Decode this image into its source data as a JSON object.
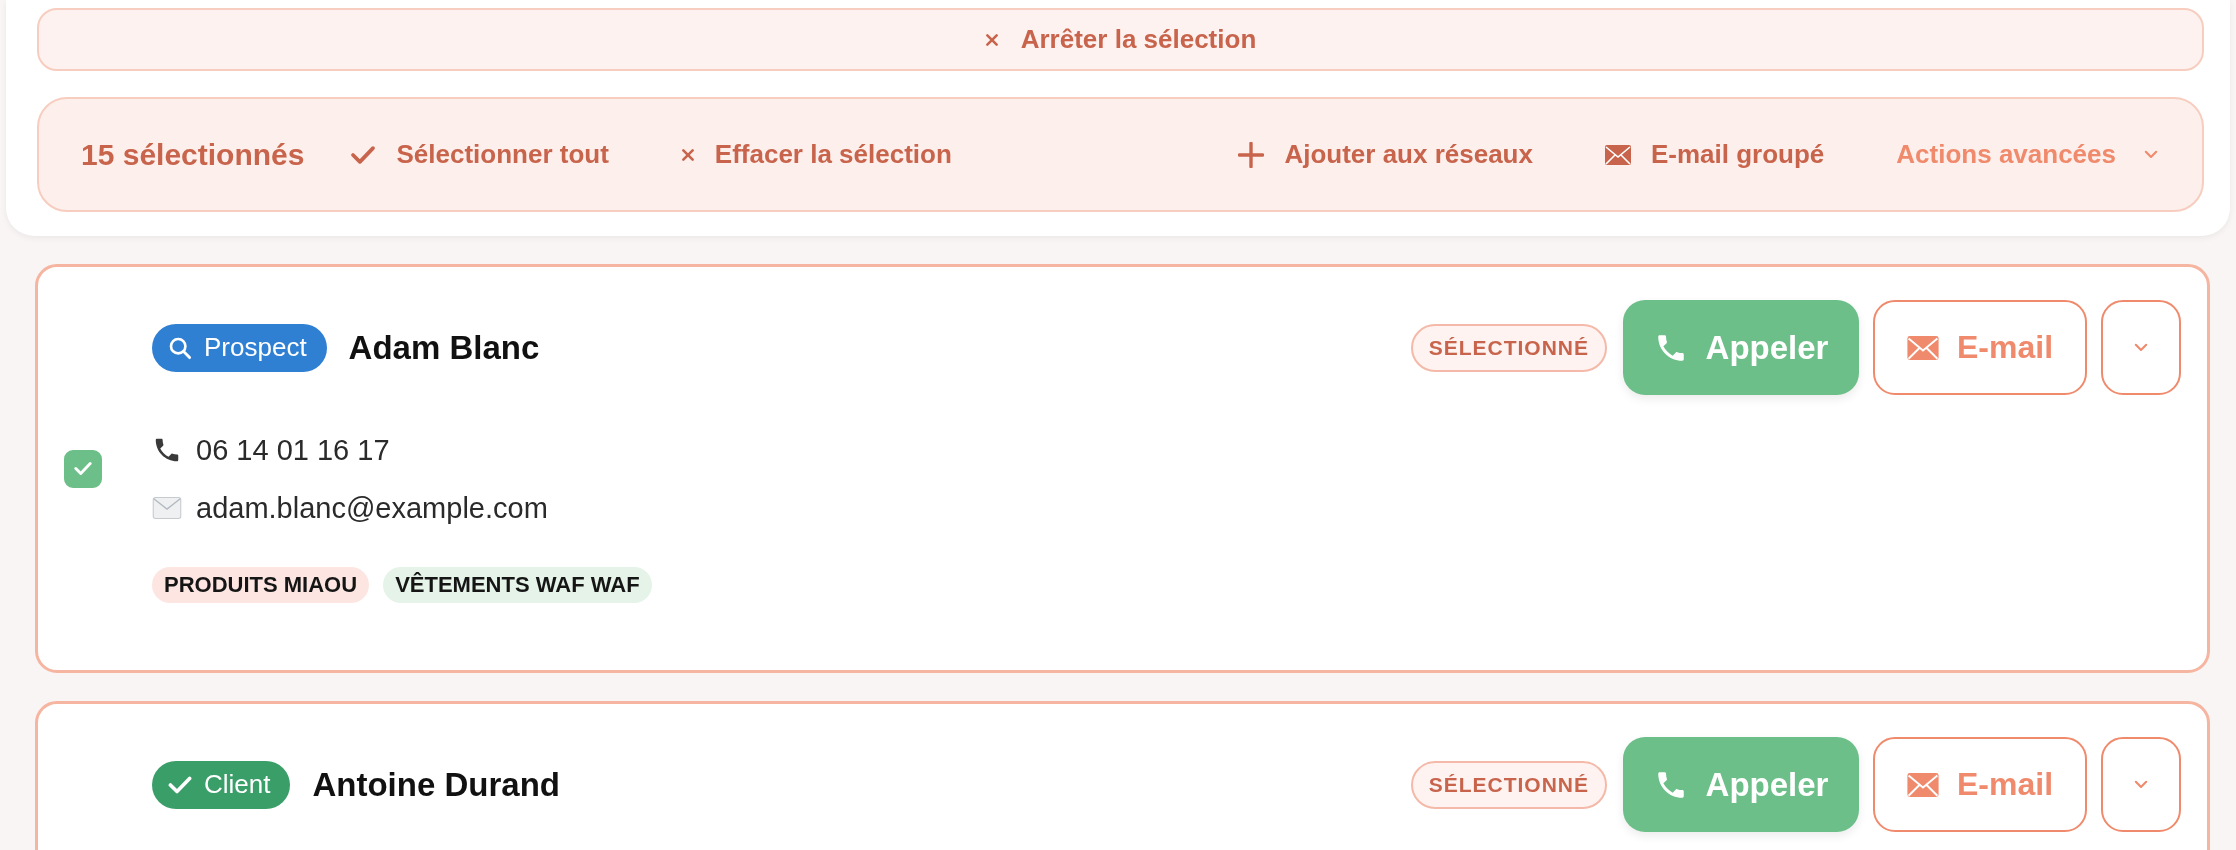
{
  "stop_selection": {
    "label": "Arrêter la sélection"
  },
  "selection_bar": {
    "count": "15 sélectionnés",
    "actions_left": [
      {
        "kind": "check",
        "label": "Sélectionner tout"
      },
      {
        "kind": "clear",
        "label": "Effacer la sélection"
      }
    ],
    "actions_right": [
      {
        "kind": "add",
        "label": "Ajouter aux réseaux"
      },
      {
        "kind": "mail",
        "label": "E-mail groupé"
      },
      {
        "kind": "menu",
        "label": "Actions avancées"
      }
    ]
  },
  "contacts": [
    {
      "kind": "prospect",
      "type_label": "Prospect",
      "name": "Adam Blanc",
      "selected": true,
      "status": "SÉLECTIONNÉ",
      "call": "Appeler",
      "email_button": "E-mail",
      "phone": "06 14 01 16 17",
      "email": "adam.blanc@example.com",
      "tags": [
        {
          "label": "PRODUITS MIAOU",
          "color": "#fde6e1"
        },
        {
          "label": "VÊTEMENTS WAF WAF",
          "color": "#e5f3e8"
        }
      ]
    },
    {
      "kind": "client",
      "type_label": "Client",
      "name": "Antoine Durand",
      "selected": true,
      "status": "SÉLECTIONNÉ",
      "call": "Appeler",
      "email_button": "E-mail"
    }
  ]
}
